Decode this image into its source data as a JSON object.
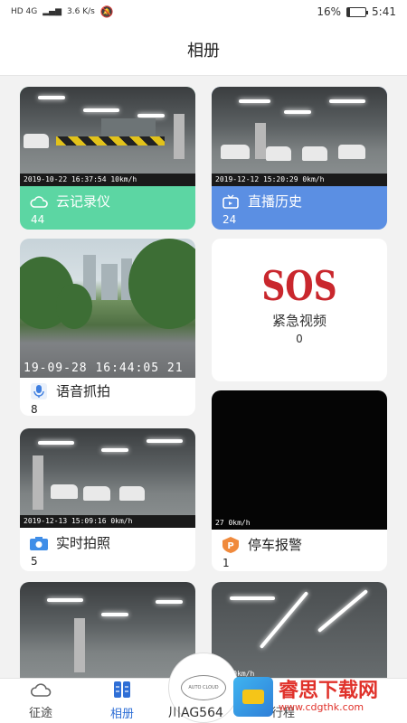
{
  "status_bar": {
    "network": "HD 4G",
    "speed": "3.6 K/s",
    "battery": "16%",
    "battery_level": 0.16,
    "time": "5:41"
  },
  "header": {
    "title": "相册"
  },
  "albums": [
    {
      "id": "cloud",
      "label": "云记录仪",
      "count": "44",
      "stamp": "2019-10-22 16:37:54 10km/h",
      "icon": "cloud-icon",
      "color": "#5cd6a3"
    },
    {
      "id": "live",
      "label": "直播历史",
      "count": "24",
      "stamp": "2019-12-12 15:20:29 0km/h",
      "icon": "tv-icon",
      "color": "#5b8fe3"
    },
    {
      "id": "voice",
      "label": "语音抓拍",
      "count": "8",
      "stamp": "19-09-28 16:44:05 21",
      "icon": "microphone-icon"
    },
    {
      "id": "sos",
      "label": "紧急视频",
      "count": "0",
      "badge": "SOS"
    },
    {
      "id": "photo",
      "label": "实时拍照",
      "count": "5",
      "stamp": "2019-12-13 15:09:16 0km/h",
      "icon": "camera-icon"
    },
    {
      "id": "parking",
      "label": "停车报警",
      "count": "1",
      "stamp": "27 0km/h",
      "icon": "parking-alert-icon"
    },
    {
      "id": "row4a",
      "stamp": ""
    },
    {
      "id": "row4b",
      "stamp": ":46 0km/h"
    }
  ],
  "tabbar": {
    "tabs": [
      {
        "label": "征途",
        "icon": "cloud-outline-icon"
      },
      {
        "label": "相册",
        "icon": "album-icon"
      }
    ],
    "plate": "川AG564",
    "right_partial": "行程",
    "fab_text": "AUTO CLOUD"
  },
  "watermark": {
    "title": "睿思下载网",
    "url": "www.cdgthk.com"
  }
}
